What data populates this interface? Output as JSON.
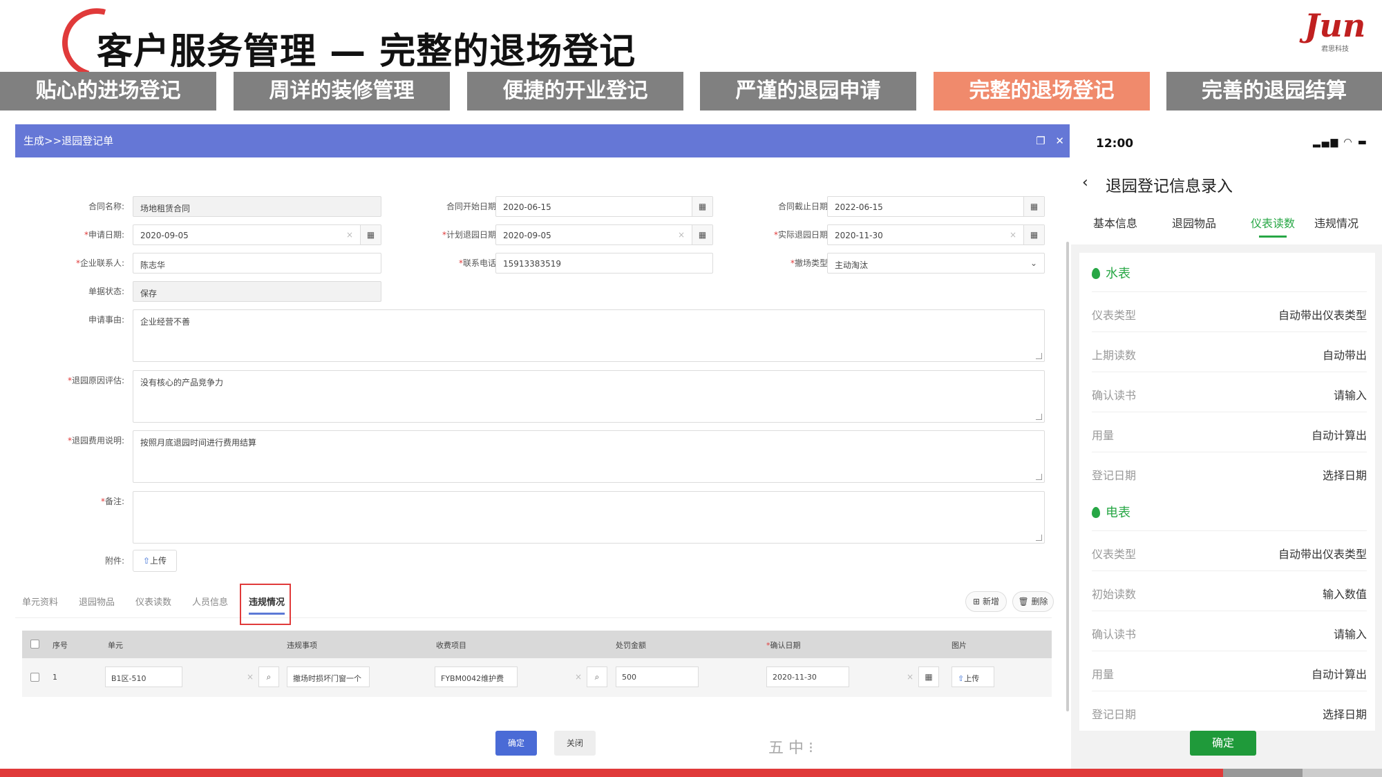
{
  "slide": {
    "title": "客户服务管理 — 完整的退场登记",
    "logo_text": "Jun",
    "logo_sub": "君思科技",
    "nav_tabs": [
      {
        "label": "贴心的进场登记",
        "active": false
      },
      {
        "label": "周详的装修管理",
        "active": false
      },
      {
        "label": "便捷的开业登记",
        "active": false
      },
      {
        "label": "严谨的退园申请",
        "active": false
      },
      {
        "label": "完整的退场登记",
        "active": true
      },
      {
        "label": "完善的退园结算",
        "active": false
      }
    ],
    "colors": {
      "accent": "#f08a6c",
      "tab_gray": "#808080",
      "brand_red": "#e03a3a",
      "window_bar": "#6577d6",
      "mobile_green": "#27a745"
    }
  },
  "web": {
    "breadcrumb": "生成>>退园登记单",
    "fields": {
      "contract_name": {
        "label": "合同名称:",
        "value": "场地租赁合同"
      },
      "contract_start": {
        "label": "合同开始日期:",
        "value": "2020-06-15"
      },
      "contract_end": {
        "label": "合同截止日期:",
        "value": "2022-06-15"
      },
      "apply_date": {
        "label": "申请日期:",
        "value": "2020-09-05"
      },
      "plan_date": {
        "label": "计划退园日期:",
        "value": "2020-09-05"
      },
      "actual_date": {
        "label": "实际退园日期:",
        "value": "2020-11-30"
      },
      "contact": {
        "label": "企业联系人:",
        "value": "陈志华"
      },
      "phone": {
        "label": "联系电话:",
        "value": "15913383519"
      },
      "exit_type": {
        "label": "撤场类型:",
        "value": "主动淘汰"
      },
      "doc_status": {
        "label": "单据状态:",
        "value": "保存"
      },
      "reason": {
        "label": "申请事由:",
        "value": "企业经营不善"
      },
      "cause": {
        "label": "退园原因评估:",
        "value": "没有核心的产品竞争力"
      },
      "fee_desc": {
        "label": "退园费用说明:",
        "value": "按照月底退园时间进行费用结算"
      },
      "remark": {
        "label": "备注:",
        "value": ""
      },
      "attachment": {
        "label": "附件:"
      }
    },
    "upload_label": "上传",
    "sub_tabs": [
      "单元资料",
      "退园物品",
      "仪表读数",
      "人员信息",
      "违规情况"
    ],
    "active_sub_tab": "违规情况",
    "toolbar": {
      "add": "新增",
      "delete": "删除"
    },
    "table": {
      "headers": [
        "序号",
        "单元",
        "违规事项",
        "收费项目",
        "处罚金额",
        "确认日期",
        "图片"
      ],
      "rows": [
        {
          "no": "1",
          "unit": "B1区-510",
          "item": "撤场时损坏门窗一个",
          "fee": "FYBM0042维护费",
          "amount": "500",
          "date": "2020-11-30",
          "pic": "上传"
        }
      ]
    },
    "buttons": {
      "ok": "确定",
      "close": "关闭"
    },
    "ime": "五 中 ⁝"
  },
  "mobile": {
    "time": "12:00",
    "signal": "▂▄▆ ◠ ▬",
    "title": "退园登记信息录入",
    "tabs": [
      "基本信息",
      "退园物品",
      "仪表读数",
      "违规情况"
    ],
    "active_tab": "仪表读数",
    "water": {
      "title": "水表",
      "rows": [
        {
          "k": "仪表类型",
          "v": "自动带出仪表类型"
        },
        {
          "k": "上期读数",
          "v": "自动带出"
        },
        {
          "k": "确认读书",
          "v": "请输入"
        },
        {
          "k": "用量",
          "v": "自动计算出"
        },
        {
          "k": "登记日期",
          "v": "选择日期"
        }
      ]
    },
    "power": {
      "title": "电表",
      "rows": [
        {
          "k": "仪表类型",
          "v": "自动带出仪表类型"
        },
        {
          "k": "初始读数",
          "v": "输入数值"
        },
        {
          "k": "确认读书",
          "v": "请输入"
        },
        {
          "k": "用量",
          "v": "自动计算出"
        },
        {
          "k": "登记日期",
          "v": "选择日期"
        }
      ]
    },
    "confirm": "确定"
  }
}
